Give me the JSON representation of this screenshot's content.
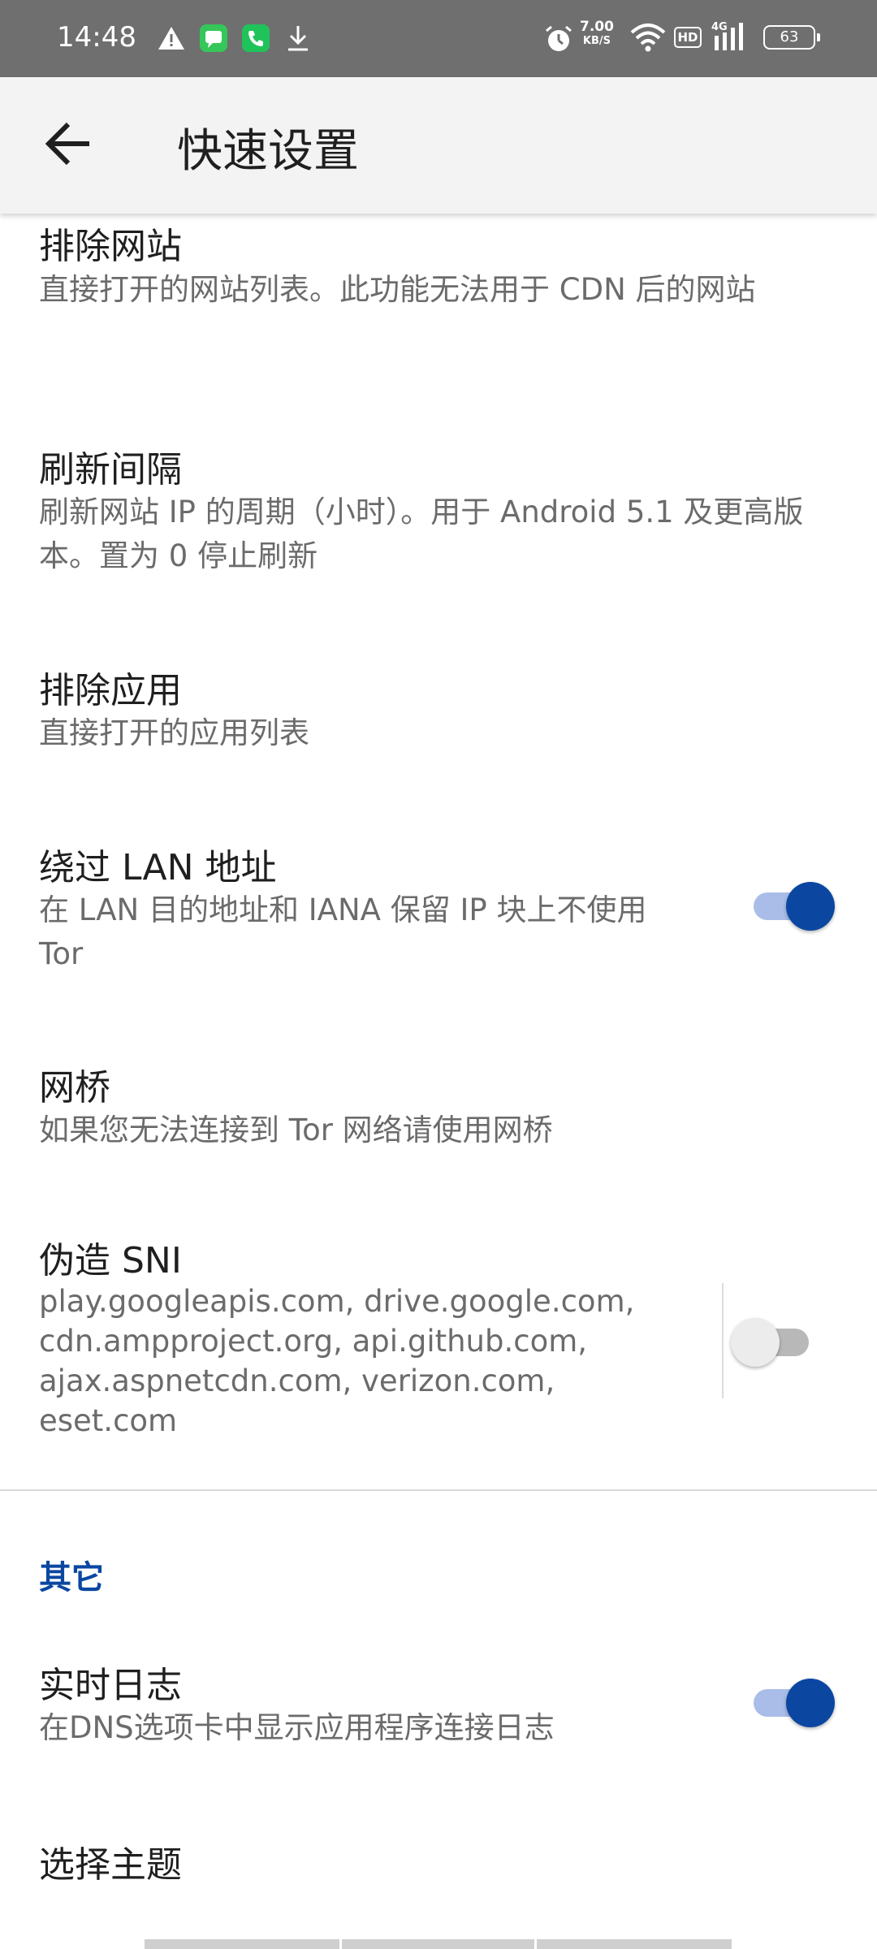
{
  "status_bar": {
    "time": "14:48",
    "speed_value": "7.00",
    "speed_unit": "KB/S",
    "hd_label": "HD",
    "network_label": "4G",
    "battery": "63",
    "icons": [
      "warning-icon",
      "message-app-icon",
      "phone-app-icon",
      "download-icon",
      "alarm-icon",
      "wifi-icon",
      "hd-icon",
      "signal-icon",
      "battery-icon"
    ]
  },
  "app_bar": {
    "title": "快速设置",
    "back_icon": "arrow-back-icon"
  },
  "settings": {
    "exclude_sites": {
      "title": "排除网站",
      "summary": "直接打开的网站列表。此功能无法用于 CDN 后的网站"
    },
    "refresh_interval": {
      "title": "刷新间隔",
      "summary": "刷新网站 IP 的周期（小时）。用于 Android 5.1 及更高版本。置为 0 停止刷新"
    },
    "exclude_apps": {
      "title": "排除应用",
      "summary": "直接打开的应用列表"
    },
    "bypass_lan": {
      "title": "绕过 LAN 地址",
      "summary": "在 LAN 目的地址和 IANA 保留 IP 块上不使用 Tor",
      "enabled": true
    },
    "bridges": {
      "title": "网桥",
      "summary": "如果您无法连接到 Tor 网络请使用网桥"
    },
    "fake_sni": {
      "title": "伪造 SNI",
      "summary_lines": [
        "play.googleapis.com, drive.google.com,",
        "cdn.ampproject.org, api.github.com,",
        "ajax.aspnetcdn.com, verizon.com,",
        "eset.com"
      ],
      "enabled": false
    },
    "other_section": {
      "header": "其它"
    },
    "realtime_log": {
      "title": "实时日志",
      "summary": "在DNS选项卡中显示应用程序连接日志",
      "enabled": true
    },
    "choose_theme": {
      "title": "选择主题"
    }
  },
  "colors": {
    "accent": "#0b47a1",
    "status_bar": "#6f6f6f",
    "app_bar": "#f3f3f3",
    "title_text": "#1f1f1f",
    "summary_text": "#6b6b6b"
  }
}
